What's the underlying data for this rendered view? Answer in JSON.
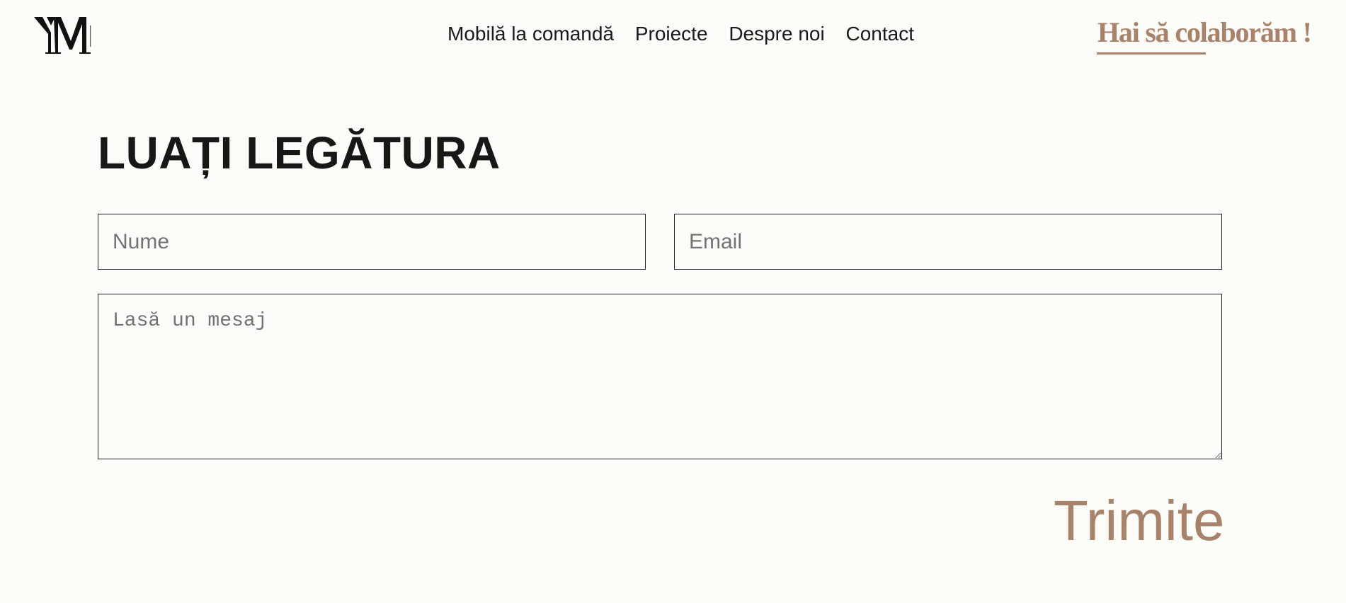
{
  "header": {
    "logo_text": "YM",
    "nav": [
      {
        "label": "Mobilă la comandă"
      },
      {
        "label": "Proiecte"
      },
      {
        "label": "Despre noi"
      },
      {
        "label": "Contact"
      }
    ],
    "cta_label": "Hai să colaborăm !"
  },
  "contact": {
    "title": "LUAȚI LEGĂTURA",
    "name_placeholder": "Nume",
    "email_placeholder": "Email",
    "message_placeholder": "Lasă un mesaj",
    "submit_label": "Trimite"
  },
  "colors": {
    "background": "#fbfcf8",
    "accent": "#a8826a",
    "text": "#1a1a1a",
    "border": "#1f1f1f"
  }
}
